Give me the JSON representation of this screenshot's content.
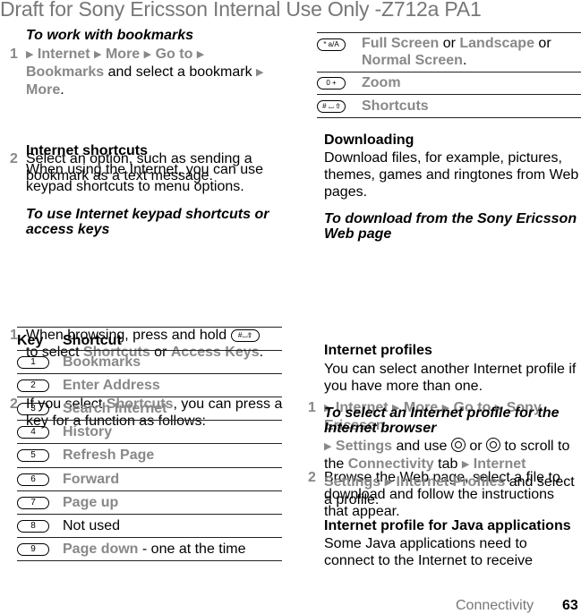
{
  "header": {
    "draft_title": "Draft for Sony Ericsson Internal Use Only -Z712a PA1"
  },
  "left": {
    "bookmarks_heading": "To work with bookmarks",
    "bookmarks_steps": [
      {
        "num": "1",
        "parts": [
          "Internet",
          "More",
          "Go to",
          "Bookmarks",
          " and select a bookmark ",
          "More",
          "."
        ]
      },
      {
        "num": "2",
        "text": "Select an option, such as sending a bookmark as a text message."
      }
    ],
    "shortcuts_heading": "Internet shortcuts",
    "shortcuts_body": "When using the Internet, you can use keypad shortcuts to menu options.",
    "keypad_heading": "To use Internet keypad shortcuts or access keys",
    "keypad_steps": [
      {
        "num": "1",
        "pre": "When browsing, press and hold",
        "post": "to select",
        "opt1": "Shortcuts",
        "or": "or",
        "opt2": "Access Keys",
        "end": "."
      },
      {
        "num": "2",
        "pre": "If you select",
        "opt": "Shortcuts",
        "post": ", you can press a key for a function as follows:"
      }
    ],
    "table": {
      "col_key": "Key",
      "col_shortcut": "Shortcut",
      "rows": [
        {
          "key": "1",
          "label": "Bookmarks",
          "menu": true
        },
        {
          "key": "2",
          "label": "Enter Address",
          "menu": true
        },
        {
          "key": "3",
          "label": "Search Internet",
          "menu": true
        },
        {
          "key": "4",
          "label": "History",
          "menu": true
        },
        {
          "key": "5",
          "label": "Refresh Page",
          "menu": true
        },
        {
          "key": "6",
          "label": "Forward",
          "menu": true
        },
        {
          "key": "7",
          "label": "Page up",
          "menu": true
        },
        {
          "key": "8",
          "label": "Not used",
          "menu": false
        },
        {
          "key": "9",
          "label": "Page down",
          "suffix": " - one at the time",
          "menu": true
        }
      ]
    }
  },
  "right": {
    "table_rows": [
      {
        "key": "* a/A",
        "opt1": "Full Screen",
        "or1": " or ",
        "opt2": "Landscape",
        "or2": " or ",
        "opt3": "Normal Screen",
        "end": "."
      },
      {
        "key": "0 +",
        "label": "Zoom"
      },
      {
        "key": "# ⌴ ⇧",
        "label": "Shortcuts"
      }
    ],
    "downloading_heading": "Downloading",
    "downloading_body": "Download files, for example, pictures, themes, games and ringtones from Web pages.",
    "download_heading": "To download from the Sony Ericsson Web page",
    "download_steps": [
      {
        "num": "1",
        "parts": [
          "Internet",
          "More",
          "Go to",
          "Sony Ericsson"
        ],
        "end": "."
      },
      {
        "num": "2",
        "text": "Browse the Web page, select a file to download and follow the instructions that appear."
      }
    ],
    "profiles_heading": "Internet profiles",
    "profiles_body": "You can select another Internet profile if you have more than one.",
    "select_profile_heading": "To select an Internet profile for the Internet browser",
    "select_profile": {
      "settings": "Settings",
      "and_use": " and use ",
      "or": " or ",
      "scroll": " to scroll to the ",
      "tab_name": "Connectivity",
      "tab": " tab ",
      "internet_settings": "Internet Settings",
      "internet_profiles": "Internet Profiles",
      "end": " and select a profile."
    },
    "java_heading": "Internet profile for Java applications",
    "java_body": "Some Java applications need to connect to the Internet to receive"
  },
  "footer": {
    "section": "Connectivity",
    "page": "63"
  }
}
